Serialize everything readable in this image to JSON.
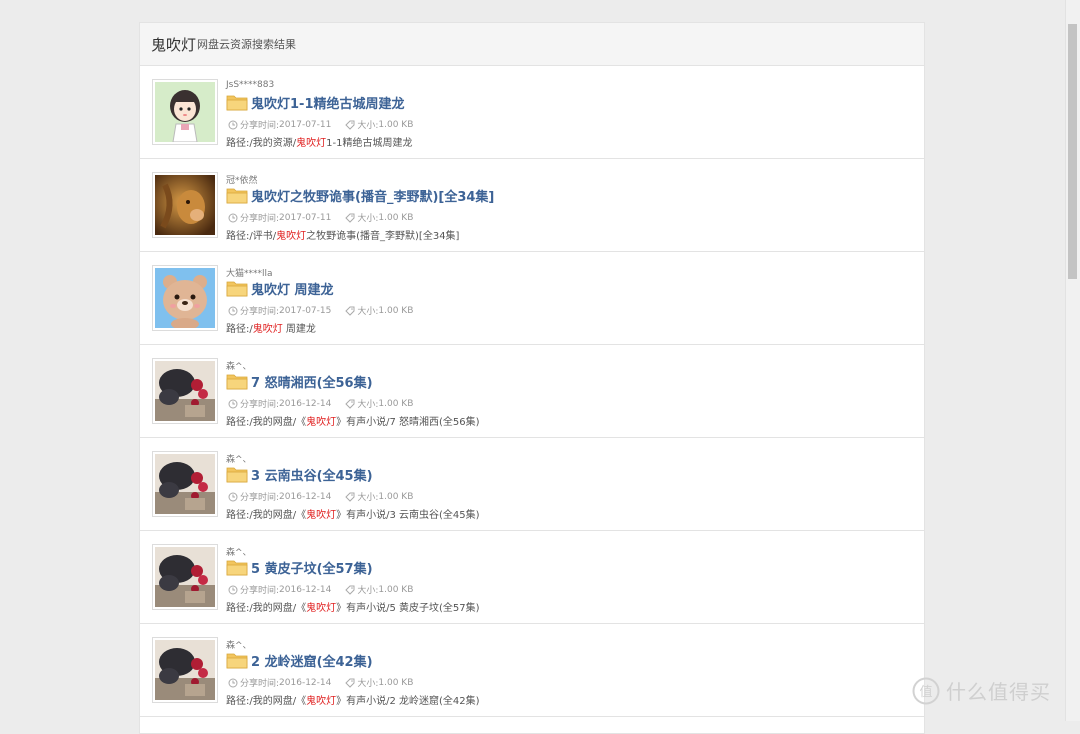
{
  "header": {
    "keyword": "鬼吹灯",
    "suffix": "网盘云资源搜索结果"
  },
  "labels": {
    "share_time": "分享时间:",
    "size": "大小:",
    "path_prefix": "路径:"
  },
  "results": [
    {
      "avatar": "girl-cartoon",
      "user": "JsS****883",
      "title": "鬼吹灯1-1精绝古城周建龙",
      "time": "2017-07-11",
      "size": "1.00 KB",
      "path_before": "/我的资源/",
      "path_keyword": "鬼吹灯",
      "path_after": "1-1精绝古城周建龙"
    },
    {
      "avatar": "lion",
      "user": "冠*依然",
      "title": "鬼吹灯之牧野诡事(播音_李野默)[全34集]",
      "time": "2017-07-11",
      "size": "1.00 KB",
      "path_before": "/评书/",
      "path_keyword": "鬼吹灯",
      "path_after": "之牧野诡事(播音_李野默)[全34集]"
    },
    {
      "avatar": "bear-cartoon",
      "user": "大猫****lla",
      "title": "鬼吹灯 周建龙",
      "time": "2017-07-15",
      "size": "1.00 KB",
      "path_before": "/",
      "path_keyword": "鬼吹灯",
      "path_after": " 周建龙"
    },
    {
      "avatar": "cat-flower",
      "user": "森^、",
      "title": "7 怒晴湘西(全56集)",
      "time": "2016-12-14",
      "size": "1.00 KB",
      "path_before": "/我的网盘/《",
      "path_keyword": "鬼吹灯",
      "path_after": "》有声小说/7 怒晴湘西(全56集)"
    },
    {
      "avatar": "cat-flower",
      "user": "森^、",
      "title": "3 云南虫谷(全45集)",
      "time": "2016-12-14",
      "size": "1.00 KB",
      "path_before": "/我的网盘/《",
      "path_keyword": "鬼吹灯",
      "path_after": "》有声小说/3 云南虫谷(全45集)"
    },
    {
      "avatar": "cat-flower",
      "user": "森^、",
      "title": "5 黄皮子坟(全57集)",
      "time": "2016-12-14",
      "size": "1.00 KB",
      "path_before": "/我的网盘/《",
      "path_keyword": "鬼吹灯",
      "path_after": "》有声小说/5 黄皮子坟(全57集)"
    },
    {
      "avatar": "cat-flower",
      "user": "森^、",
      "title": "2 龙岭迷窟(全42集)",
      "time": "2016-12-14",
      "size": "1.00 KB",
      "path_before": "/我的网盘/《",
      "path_keyword": "鬼吹灯",
      "path_after": "》有声小说/2 龙岭迷窟(全42集)"
    }
  ],
  "watermark": {
    "text": "什么值得买",
    "logo": "值"
  },
  "icons": {
    "folder": "folder-icon",
    "clock": "clock-icon",
    "tag": "tag-icon"
  }
}
